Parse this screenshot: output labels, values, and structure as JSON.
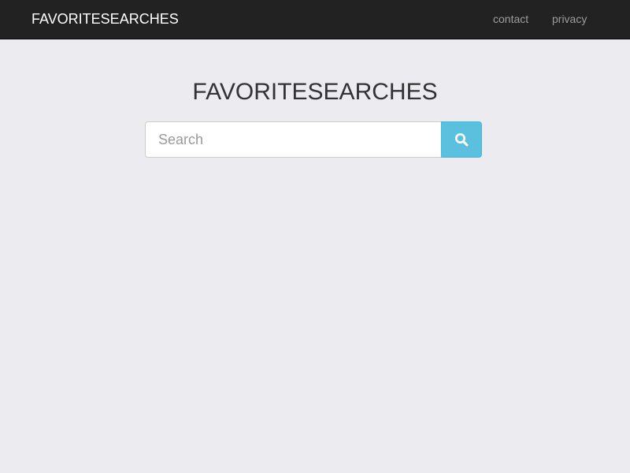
{
  "navbar": {
    "brand": "FAVORITESEARCHES",
    "links": [
      {
        "label": "contact"
      },
      {
        "label": "privacy"
      }
    ]
  },
  "main": {
    "title": "FAVORITESEARCHES",
    "search": {
      "placeholder": "Search",
      "value": "",
      "button_icon": "search-icon"
    }
  },
  "colors": {
    "navbar_bg": "#222222",
    "page_bg": "#ecebf0",
    "search_button": "#5bc0de",
    "brand_text": "#ffffff",
    "nav_link_text": "#9d9d9d"
  }
}
